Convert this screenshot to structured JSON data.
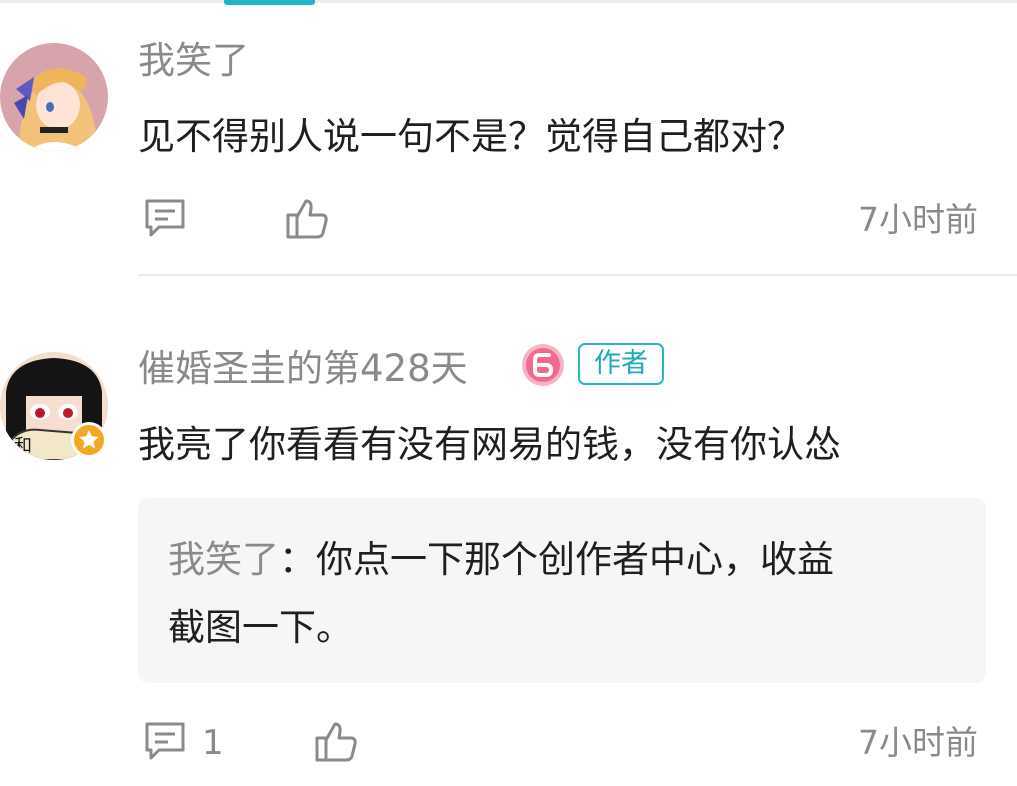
{
  "comments": [
    {
      "username": "我笑了",
      "text": "见不得别人说一句不是？觉得自己都对？",
      "reply_count": "",
      "time": "7小时前"
    },
    {
      "username": "催婚圣圭的第428天",
      "author_tag": "作者",
      "text": "我亮了你看看有没有网易的钱，没有你认怂",
      "quote": {
        "author": "我笑了",
        "separator": "：",
        "line1": "你点一下那个创作者中心，收益",
        "line2": "截图一下。"
      },
      "reply_count": "1",
      "time": "7小时前"
    }
  ],
  "colors": {
    "accent": "#22b5c8",
    "meta_text": "#8a8a8a",
    "primary_text": "#1f1f1f",
    "quote_bg": "#f6f6f6",
    "level_badge": "#f06a8c",
    "vip_star": "#f5a623"
  },
  "icons": [
    "reply-icon",
    "like-icon",
    "level-badge-icon",
    "vip-star-icon"
  ]
}
